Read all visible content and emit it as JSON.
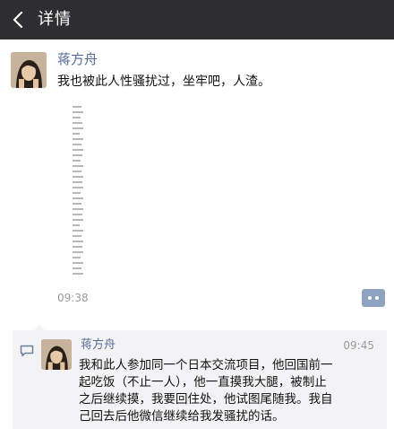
{
  "header": {
    "title": "详情",
    "back_icon": "chevron-left-icon",
    "background": "#2e2e30"
  },
  "post": {
    "author": "蒋方舟",
    "text": "我也被此人性骚扰过，坐牢吧，人渣。",
    "time": "09:38",
    "image_note_icon": "image-thumbnail",
    "comment_icon": "more-dots-icon"
  },
  "comment": {
    "icon": "comment-bubble-icon",
    "author": "蒋方舟",
    "time": "09:45",
    "lines": [
      "我和此人参加同一个日本交流项目，他回国前一",
      "起吃饭（不止一人），他一直摸我大腿，被制止",
      "之后继续摸，我要回住处，他试图尾随我。我自",
      "己回去后他微信继续给我发骚扰的话。"
    ]
  },
  "colors": {
    "name_link": "#576b95",
    "timestamp": "#9a9a9a",
    "comment_bg": "#f3f3f5"
  }
}
